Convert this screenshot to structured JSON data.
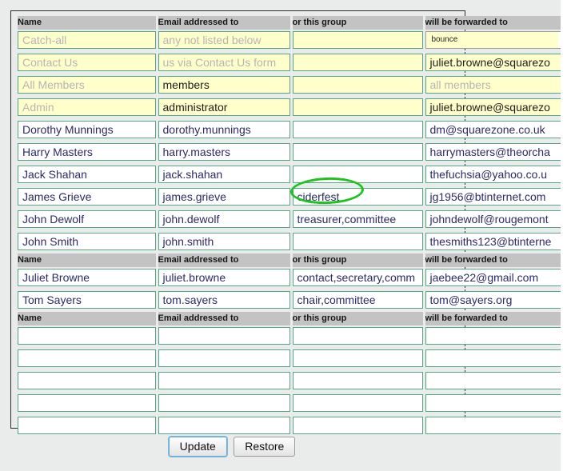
{
  "table": {
    "columns": [
      "Name",
      "Email addressed to",
      "or this group",
      "will be forwarded to"
    ],
    "rows": [
      {
        "kind": "header"
      },
      {
        "kind": "data",
        "locked": true,
        "name": "Catch-all",
        "name_placeholder": true,
        "email": "any not listed below",
        "email_placeholder": true,
        "group": "",
        "group_locked": true,
        "forward_type": "select",
        "forward": "bounce"
      },
      {
        "kind": "data",
        "locked": true,
        "name": "Contact Us",
        "name_placeholder": true,
        "email": "us via Contact Us form",
        "email_placeholder": true,
        "group": "",
        "group_locked": true,
        "forward_type": "text",
        "forward": "juliet.browne@squarezo",
        "forward_style": "filled-locked"
      },
      {
        "kind": "data",
        "locked": true,
        "name": "All Members",
        "name_placeholder": true,
        "email": "members",
        "email_placeholder": false,
        "group": "",
        "group_locked": true,
        "forward_type": "text",
        "forward": "all members",
        "forward_style": "locked"
      },
      {
        "kind": "data",
        "locked": true,
        "name": "Admin",
        "name_placeholder": true,
        "email": "administrator",
        "email_placeholder": false,
        "group": "",
        "group_locked": true,
        "forward_type": "text",
        "forward": "juliet.browne@squarezo",
        "forward_style": "filled-locked"
      },
      {
        "kind": "data",
        "locked": false,
        "name": "Dorothy Munnings",
        "email": "dorothy.munnings",
        "group": "",
        "forward_type": "text",
        "forward": "dm@squarezone.co.uk"
      },
      {
        "kind": "data",
        "locked": false,
        "name": "Harry Masters",
        "email": "harry.masters",
        "group": "",
        "forward_type": "text",
        "forward": "harrymasters@theorcha"
      },
      {
        "kind": "data",
        "locked": false,
        "name": "Jack Shahan",
        "email": "jack.shahan",
        "group": "",
        "forward_type": "text",
        "forward": "thefuchsia@yahoo.co.u"
      },
      {
        "kind": "data",
        "locked": false,
        "name": "James Grieve",
        "email": "james.grieve",
        "group": "ciderfest",
        "forward_type": "text",
        "forward": "jg1956@btinternet.com"
      },
      {
        "kind": "data",
        "locked": false,
        "name": "John Dewolf",
        "email": "john.dewolf",
        "group": "treasurer,committee",
        "forward_type": "text",
        "forward": "johndewolf@rougemont"
      },
      {
        "kind": "data",
        "locked": false,
        "name": "John Smith",
        "email": "john.smith",
        "group": "",
        "forward_type": "text",
        "forward": "thesmiths123@btinterne"
      },
      {
        "kind": "header"
      },
      {
        "kind": "data",
        "locked": false,
        "name": "Juliet Browne",
        "email": "juliet.browne",
        "group": "contact,secretary,comm",
        "forward_type": "text",
        "forward": "jaebee22@gmail.com"
      },
      {
        "kind": "data",
        "locked": false,
        "name": "Tom Sayers",
        "email": "tom.sayers",
        "group": "chair,committee",
        "forward_type": "text",
        "forward": "tom@sayers.org"
      },
      {
        "kind": "header"
      },
      {
        "kind": "data",
        "locked": false,
        "name": "",
        "email": "",
        "group": "",
        "forward_type": "text",
        "forward": ""
      },
      {
        "kind": "data",
        "locked": false,
        "name": "",
        "email": "",
        "group": "",
        "forward_type": "text",
        "forward": ""
      },
      {
        "kind": "data",
        "locked": false,
        "name": "",
        "email": "",
        "group": "",
        "forward_type": "text",
        "forward": ""
      },
      {
        "kind": "data",
        "locked": false,
        "name": "",
        "email": "",
        "group": "",
        "forward_type": "text",
        "forward": ""
      },
      {
        "kind": "data",
        "locked": false,
        "name": "",
        "email": "",
        "group": "",
        "forward_type": "text",
        "forward": ""
      }
    ]
  },
  "annotation": {
    "target_text": "ciderfest",
    "shape": "ellipse",
    "color": "#1fc21f"
  },
  "buttons": {
    "update_label": "Update",
    "restore_label": "Restore"
  },
  "colors": {
    "header_bg": "#c3c3c3",
    "page_bg": "#e9ecea",
    "input_border": "#56a585",
    "locked_bg": "#ffffcc",
    "input_text": "#2b2b66",
    "annotation": "#1fc21f"
  }
}
